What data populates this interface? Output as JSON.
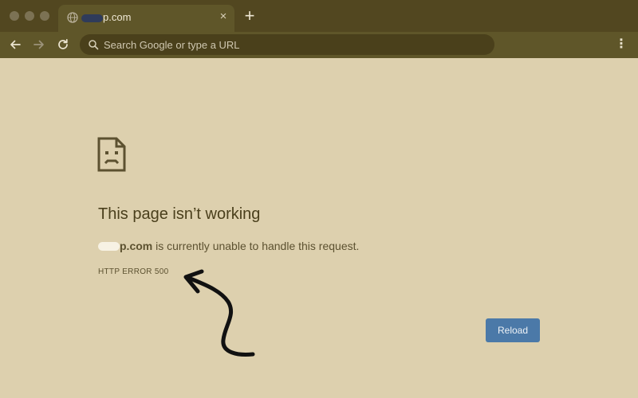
{
  "browser": {
    "tab": {
      "title_visible": "p.com",
      "favicon": "globe-icon",
      "close": "×"
    },
    "new_tab": "+",
    "toolbar": {
      "back_icon": "arrow-left-icon",
      "forward_icon": "arrow-right-icon",
      "reload_icon": "reload-icon",
      "search_icon": "search-icon",
      "omnibox_placeholder": "Search Google or type a URL",
      "menu": "⋮"
    }
  },
  "error": {
    "icon": "sad-document-icon",
    "title": "This page isn’t working",
    "domain": "p.com",
    "description_suffix": " is currently unable to handle this request.",
    "code": "HTTP ERROR 500",
    "reload_label": "Reload"
  },
  "annotation": {
    "type": "hand-drawn-arrow",
    "points_to": "error-code"
  },
  "colors": {
    "page_background": "#ddd0ae",
    "tabstrip": "#524720",
    "toolbar": "#5f5629",
    "reload_button": "#4b79a8",
    "text": "#4a3f1c"
  }
}
